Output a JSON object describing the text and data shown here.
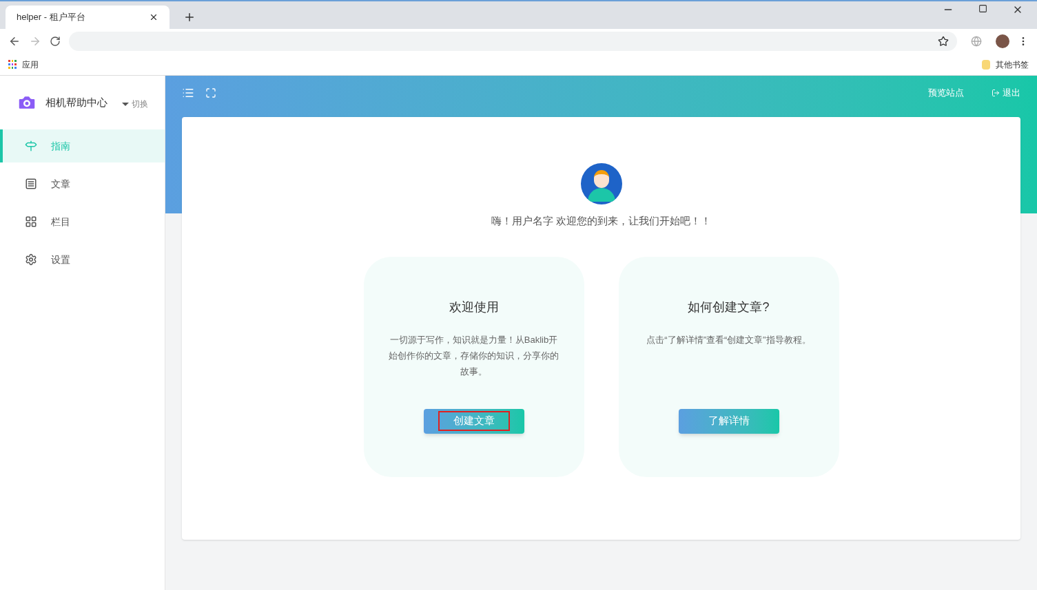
{
  "browser": {
    "tab": {
      "title": "helper - 租户平台",
      "selected": true
    },
    "bookmarks": [
      {
        "kind": "apps",
        "label": "应用"
      },
      {
        "kind": "folder",
        "label": "其他书签"
      }
    ]
  },
  "sidebar": {
    "site_name": "相机帮助中心",
    "switch_label": "切换",
    "items": [
      {
        "kind": "guide",
        "label": "指南",
        "selected": true
      },
      {
        "kind": "article",
        "label": "文章",
        "selected": false
      },
      {
        "kind": "column",
        "label": "栏目",
        "selected": false
      },
      {
        "kind": "settings",
        "label": "设置",
        "selected": false
      }
    ]
  },
  "header": {
    "preview": "预览站点",
    "logout": "退出"
  },
  "welcome": {
    "greeting": "嗨！用户名字 欢迎您的到来，让我们开始吧！！",
    "cards": [
      {
        "title": "欢迎使用",
        "text": "一切源于写作，知识就是力量！从Baklib开始创作你的文章，存储你的知识，分享你的故事。",
        "button": "创建文章",
        "highlighted": true
      },
      {
        "title": "如何创建文章?",
        "text": "点击“了解详情”查看“创建文章”指导教程。",
        "button": "了解详情",
        "highlighted": false
      }
    ]
  }
}
